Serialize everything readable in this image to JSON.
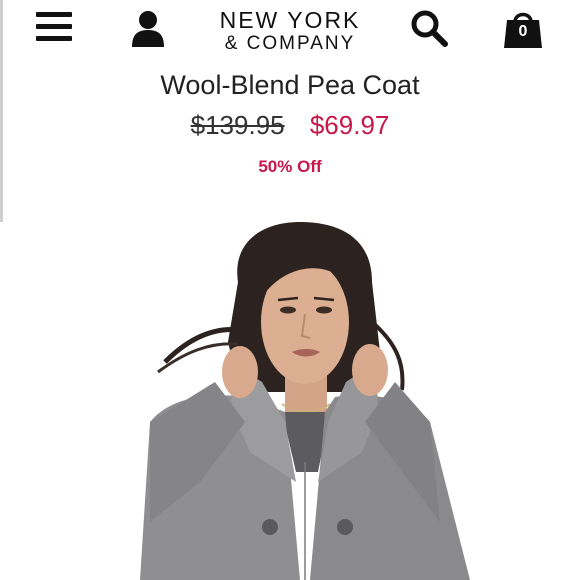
{
  "header": {
    "menu_icon": "hamburger-menu-icon",
    "account_icon": "user-icon",
    "brand_line1": "NEW YORK",
    "brand_line2": "& COMPANY",
    "search_icon": "search-icon",
    "cart_icon": "shopping-bag-icon",
    "cart_count": "0"
  },
  "product": {
    "name": "Wool-Blend Pea Coat",
    "original_price": "$139.95",
    "sale_price": "$69.97",
    "discount": "50% Off",
    "image_icon": "product-photo"
  },
  "colors": {
    "accent": "#c8174a",
    "text": "#222222",
    "coat": "#8f8f92"
  }
}
